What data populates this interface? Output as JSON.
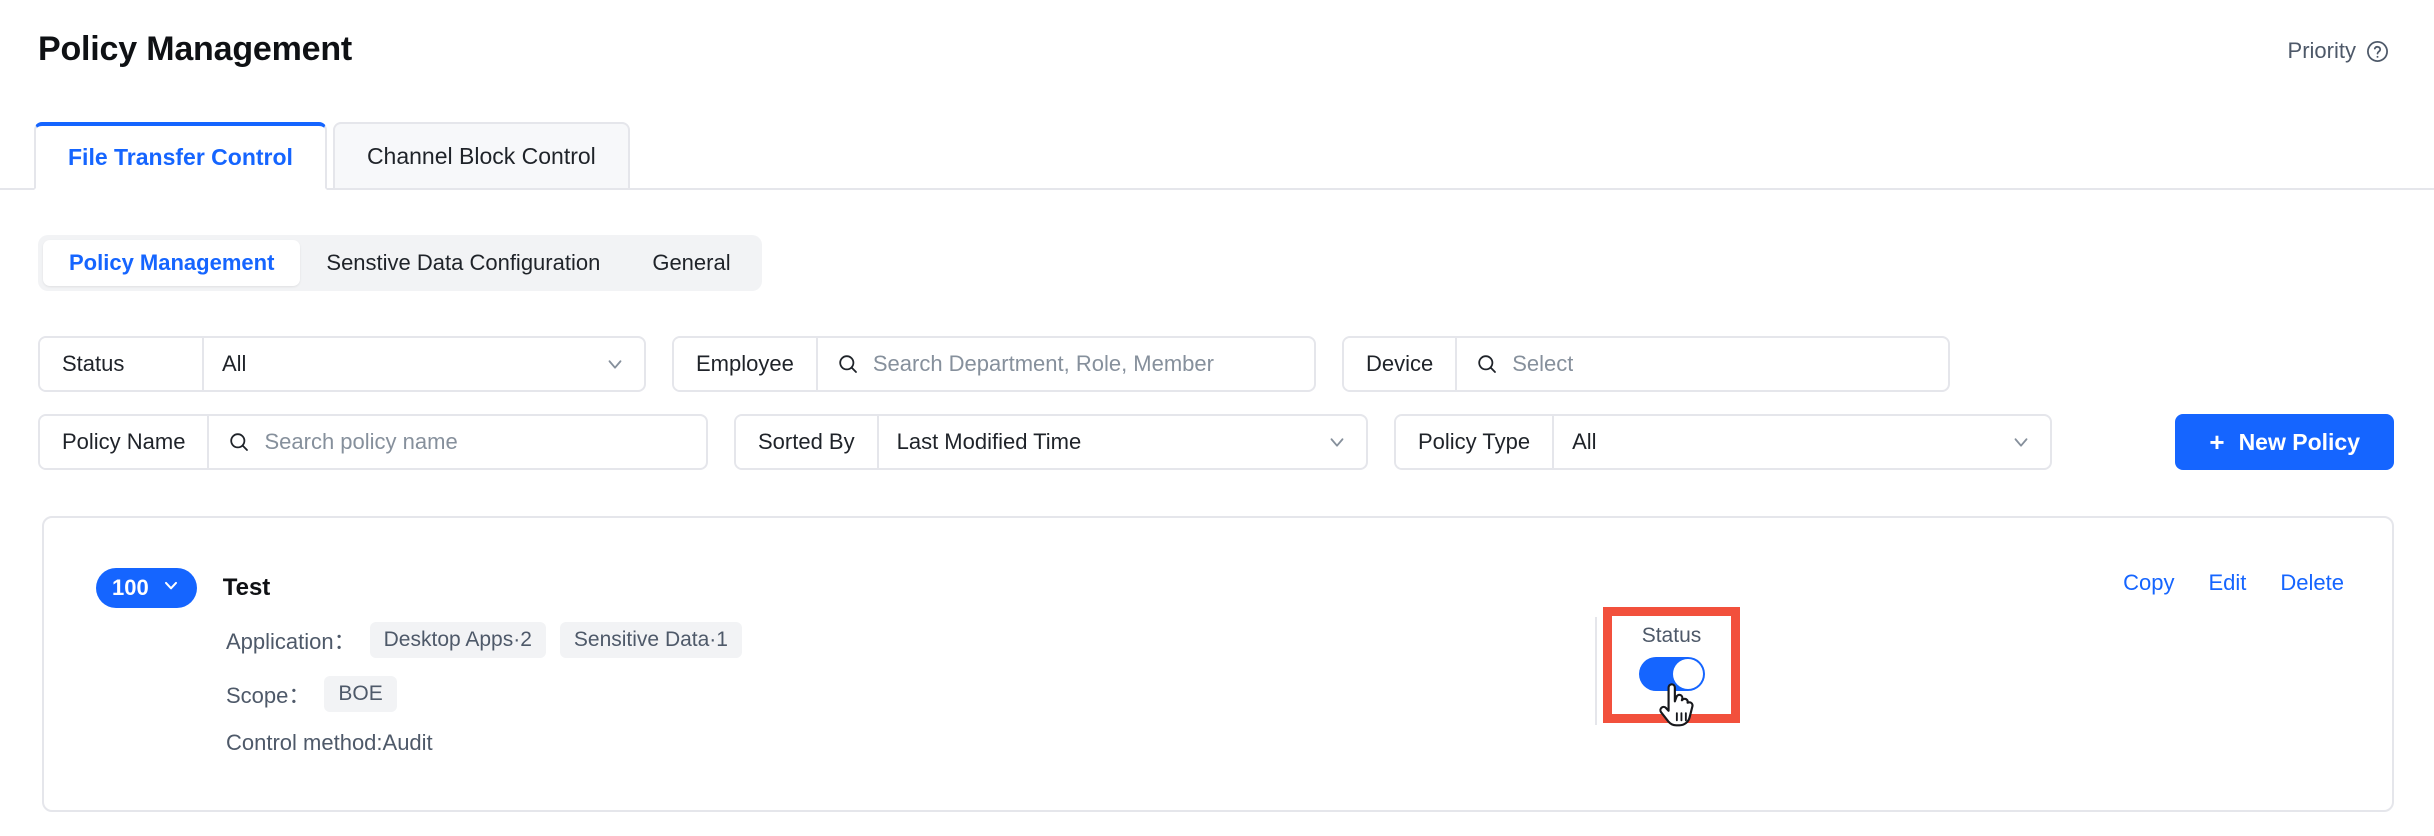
{
  "header": {
    "title": "Policy Management",
    "priority_label": "Priority",
    "help_icon": "question-circle-icon"
  },
  "main_tabs": [
    {
      "label": "File Transfer Control",
      "active": true
    },
    {
      "label": "Channel Block Control",
      "active": false
    }
  ],
  "sub_tabs": [
    {
      "label": "Policy Management",
      "active": true
    },
    {
      "label": "Senstive Data Configuration",
      "active": false
    },
    {
      "label": "General",
      "active": false
    }
  ],
  "filters": {
    "status": {
      "label": "Status",
      "value": "All",
      "icon": "chevron-down-icon"
    },
    "employee": {
      "label": "Employee",
      "placeholder": "Search Department, Role, Member",
      "icon": "search-icon"
    },
    "device": {
      "label": "Device",
      "placeholder": "Select",
      "icon": "search-icon"
    },
    "policy_name": {
      "label": "Policy Name",
      "placeholder": "Search policy name",
      "icon": "search-icon"
    },
    "sorted_by": {
      "label": "Sorted By",
      "value": "Last Modified Time",
      "icon": "chevron-down-icon"
    },
    "policy_type": {
      "label": "Policy Type",
      "value": "All",
      "icon": "chevron-down-icon"
    },
    "new_policy_button": {
      "label": "New Policy",
      "icon": "plus-icon"
    }
  },
  "policy": {
    "priority": "100",
    "priority_icon": "chevron-down-icon",
    "name": "Test",
    "application_label": "Application：",
    "application_chips": [
      "Desktop Apps·2",
      "Sensitive Data·1"
    ],
    "scope_label": "Scope：",
    "scope_chips": [
      "BOE"
    ],
    "control_method": "Control method:Audit",
    "actions": [
      "Copy",
      "Edit",
      "Delete"
    ],
    "status": {
      "label": "Status",
      "toggle_on": true,
      "highlight_color": "#f2503c"
    }
  },
  "colors": {
    "accent": "#1565ff",
    "border": "#e5e6eb",
    "muted_text": "#4e5969",
    "chip_bg": "#f2f3f5",
    "highlight": "#f2503c"
  }
}
